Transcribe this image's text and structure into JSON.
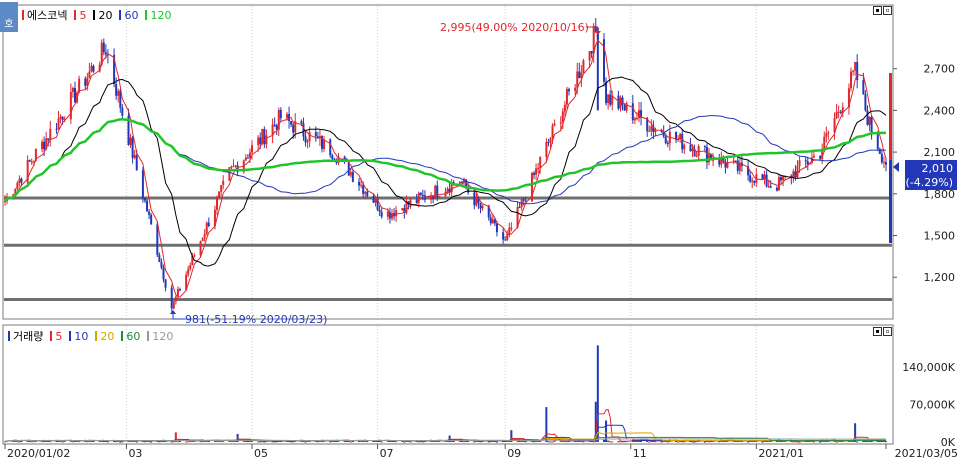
{
  "window": {
    "tab_label": "호"
  },
  "price_legend": {
    "name": "에스코넥",
    "items": [
      {
        "label": "5",
        "color": "#e0282d"
      },
      {
        "label": "20",
        "color": "#000000"
      },
      {
        "label": "60",
        "color": "#2238b8"
      },
      {
        "label": "120",
        "color": "#22c42a"
      }
    ]
  },
  "volume_legend": {
    "name": "거래량",
    "items": [
      {
        "label": "5",
        "color": "#e0282d"
      },
      {
        "label": "10",
        "color": "#2238b8"
      },
      {
        "label": "20",
        "color": "#d9a400"
      },
      {
        "label": "60",
        "color": "#1e8c3c"
      },
      {
        "label": "120",
        "color": "#999999"
      }
    ]
  },
  "annotations": {
    "high": "2,995(49.00% 2020/10/16)",
    "low": "981(-51.19% 2020/03/23)"
  },
  "current": {
    "price": "2,010",
    "change": "(-4.29%)"
  },
  "chart_data": [
    {
      "type": "candlestick",
      "title": "에스코넥",
      "y_ticks": [
        "2,700",
        "2,400",
        "2,100",
        "1,800",
        "1,500",
        "1,200"
      ],
      "ylim": [
        950,
        3050
      ],
      "x_ticks": [
        "2020/01/02",
        "03",
        "05",
        "07",
        "09",
        "11",
        "2021/01",
        "2021/03/05"
      ],
      "moving_averages": [
        "5",
        "20",
        "60",
        "120"
      ],
      "horizontal_lines": [
        1770,
        1430,
        1040
      ],
      "key_points": [
        {
          "date": "2020/01/02",
          "price": 1750
        },
        {
          "date": "2020/02/20",
          "price": 2850
        },
        {
          "date": "2020/03/23",
          "price": 981
        },
        {
          "date": "2020/04/20",
          "price": 1950
        },
        {
          "date": "2020/05/15",
          "price": 2350
        },
        {
          "date": "2020/06/10",
          "price": 2100
        },
        {
          "date": "2020/07/05",
          "price": 1650
        },
        {
          "date": "2020/08/10",
          "price": 1900
        },
        {
          "date": "2020/09/01",
          "price": 1450
        },
        {
          "date": "2020/10/16",
          "price": 2995
        },
        {
          "date": "2020/10/20",
          "price": 2500
        },
        {
          "date": "2020/11/15",
          "price": 2250
        },
        {
          "date": "2020/12/20",
          "price": 2000
        },
        {
          "date": "2021/01/10",
          "price": 1850
        },
        {
          "date": "2021/02/01",
          "price": 2100
        },
        {
          "date": "2021/02/18",
          "price": 2680
        },
        {
          "date": "2021/02/25",
          "price": 2300
        },
        {
          "date": "2021/03/05",
          "price": 2010
        }
      ],
      "current_price": 2010,
      "current_change_pct": -4.29
    },
    {
      "type": "bar",
      "title": "거래량",
      "y_ticks": [
        "140,000K",
        "70,000K",
        "0K"
      ],
      "ylim": [
        0,
        190000
      ],
      "unit": "K",
      "spikes": [
        {
          "date": "2020/03/25",
          "value": 18000
        },
        {
          "date": "2020/04/25",
          "value": 15000
        },
        {
          "date": "2020/08/05",
          "value": 12000
        },
        {
          "date": "2020/09/05",
          "value": 22000
        },
        {
          "date": "2020/09/20",
          "value": 65000
        },
        {
          "date": "2020/10/15",
          "value": 75000
        },
        {
          "date": "2020/10/16",
          "value": 180000
        },
        {
          "date": "2020/10/20",
          "value": 40000
        },
        {
          "date": "2021/02/18",
          "value": 35000
        }
      ]
    }
  ]
}
